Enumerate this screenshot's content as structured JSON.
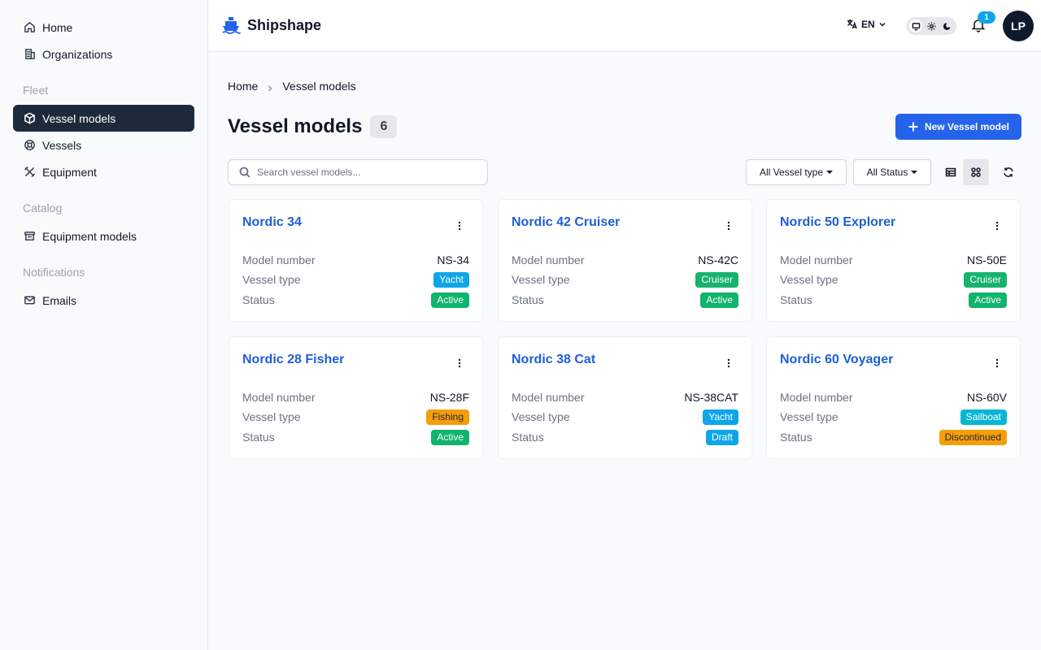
{
  "sidebar": {
    "items_top": [
      {
        "label": "Home",
        "icon": "home-icon"
      },
      {
        "label": "Organizations",
        "icon": "building-icon"
      }
    ],
    "sections": {
      "fleet": "Fleet",
      "catalog": "Catalog",
      "notifications": "Notifications"
    },
    "fleet_items": [
      {
        "label": "Vessel models",
        "icon": "cube-icon",
        "active": true
      },
      {
        "label": "Vessels",
        "icon": "lifebuoy-icon"
      },
      {
        "label": "Equipment",
        "icon": "tools-icon"
      }
    ],
    "catalog_items": [
      {
        "label": "Equipment models",
        "icon": "archive-icon"
      }
    ],
    "notification_items": [
      {
        "label": "Emails",
        "icon": "mail-icon"
      }
    ]
  },
  "header": {
    "app_name": "Shipshape",
    "language": "EN",
    "notification_count": "1",
    "user_initials": "LP"
  },
  "breadcrumb": {
    "home": "Home",
    "current": "Vessel models"
  },
  "page": {
    "title": "Vessel models",
    "count": "6",
    "new_button": "New Vessel model",
    "search_placeholder": "Search vessel models...",
    "filter_type": "All Vessel type",
    "filter_status": "All Status"
  },
  "labels": {
    "model_number": "Model number",
    "vessel_type": "Vessel type",
    "status": "Status"
  },
  "colors": {
    "accent": "#2563eb",
    "yacht": "#0ea5e9",
    "cruiser": "#16b36e",
    "fishing": "#f59e0b",
    "sailboat": "#06b6d4",
    "active": "#10b46c",
    "draft": "#0ea5e9",
    "discontinued": "#f59e0b"
  },
  "cards": [
    {
      "name": "Nordic 34",
      "model_number": "NS-34",
      "vessel_type": "Yacht",
      "status": "Active"
    },
    {
      "name": "Nordic 42 Cruiser",
      "model_number": "NS-42C",
      "vessel_type": "Cruiser",
      "status": "Active"
    },
    {
      "name": "Nordic 50 Explorer",
      "model_number": "NS-50E",
      "vessel_type": "Cruiser",
      "status": "Active"
    },
    {
      "name": "Nordic 28 Fisher",
      "model_number": "NS-28F",
      "vessel_type": "Fishing",
      "status": "Active"
    },
    {
      "name": "Nordic 38 Cat",
      "model_number": "NS-38CAT",
      "vessel_type": "Yacht",
      "status": "Draft"
    },
    {
      "name": "Nordic 60 Voyager",
      "model_number": "NS-60V",
      "vessel_type": "Sailboat",
      "status": "Discontinued"
    }
  ]
}
